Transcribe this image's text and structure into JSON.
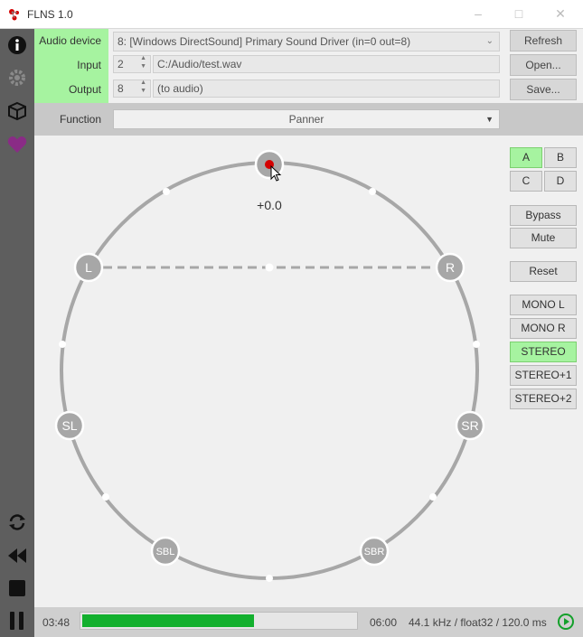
{
  "app": {
    "title": "FLNS 1.0"
  },
  "audio_device": {
    "label": "Audio device",
    "value": "8: [Windows DirectSound] Primary Sound Driver  (in=0 out=8)"
  },
  "input": {
    "label": "Input",
    "channel": "2",
    "value": "C:/Audio/test.wav"
  },
  "output": {
    "label": "Output",
    "channel": "8",
    "value": "(to audio)"
  },
  "buttons": {
    "refresh": "Refresh",
    "open": "Open...",
    "save": "Save..."
  },
  "function": {
    "label": "Function",
    "value": "Panner"
  },
  "panner": {
    "readout": "+0.0",
    "speakers": [
      "L",
      "R",
      "SL",
      "SR",
      "SBL",
      "SBR"
    ]
  },
  "right_panel": {
    "presets": [
      "A",
      "B",
      "C",
      "D"
    ],
    "active_preset": "A",
    "bypass": "Bypass",
    "mute": "Mute",
    "reset": "Reset",
    "modes": [
      "MONO L",
      "MONO R",
      "STEREO",
      "STEREO+1",
      "STEREO+2"
    ],
    "active_mode": "STEREO"
  },
  "status": {
    "elapsed": "03:48",
    "total": "06:00",
    "format": "44.1 kHz / float32 / 120.0 ms",
    "progress": 0.63
  },
  "colors": {
    "accent_green": "#a6f3a0",
    "progress_green": "#13b02e",
    "sidebar": "#5e5e5e",
    "heart": "#8a2b86",
    "source_red": "#d40000"
  }
}
